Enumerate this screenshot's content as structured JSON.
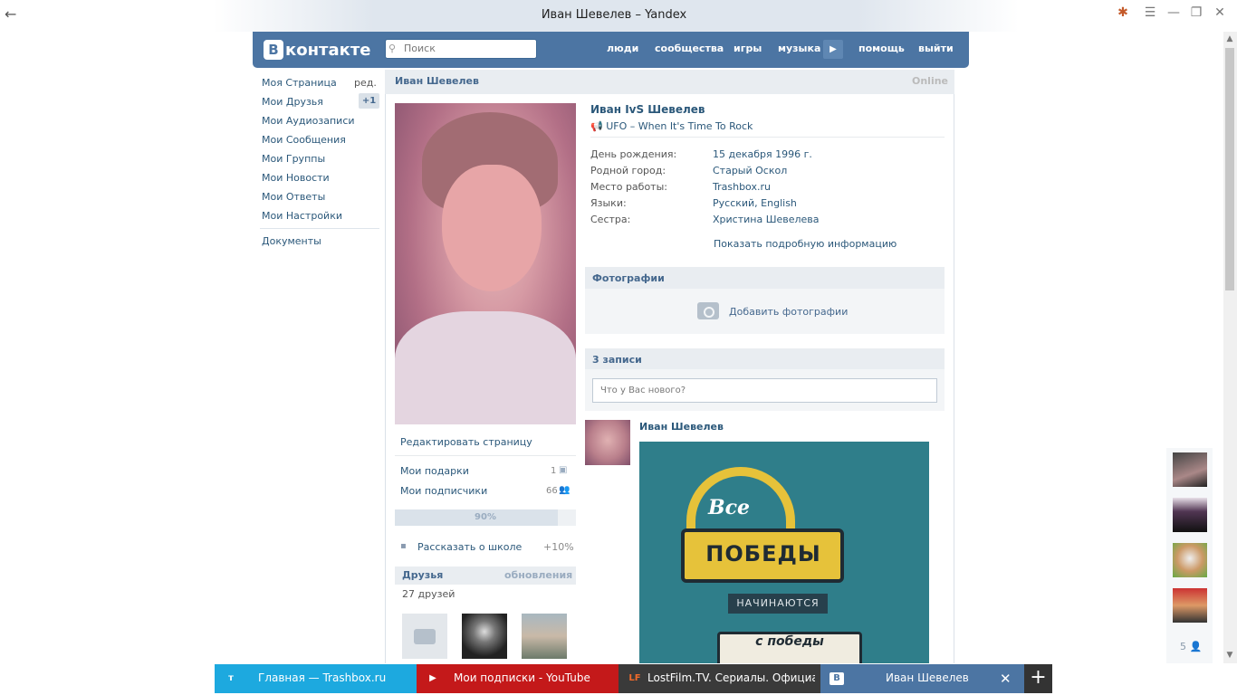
{
  "browser": {
    "window_title": "Иван Шевелев – Yandex",
    "back_glyph": "←",
    "controls": {
      "addon": "✱",
      "menu": "☰",
      "minimize": "—",
      "restore": "❐",
      "close": "✕"
    }
  },
  "header": {
    "logo_letter": "В",
    "logo_text": "контакте",
    "search_placeholder": "Поиск",
    "nav": [
      "люди",
      "сообщества",
      "игры",
      "музыка",
      "помощь",
      "выйти"
    ],
    "music_play": "▶"
  },
  "menu": {
    "edit": "ред.",
    "friends_badge": "+1",
    "items": [
      "Моя Страница",
      "Мои Друзья",
      "Мои Аудиозаписи",
      "Мои Сообщения",
      "Мои Группы",
      "Мои Новости",
      "Мои Ответы",
      "Мои Настройки"
    ],
    "documents": "Документы"
  },
  "page": {
    "header_name": "Иван Шевелев",
    "online": "Online",
    "edit_page": "Редактировать страницу",
    "gifts_label": "Мои подарки",
    "gifts_count": "1",
    "followers_label": "Мои подписчики",
    "followers_count": "66",
    "progress_label": "90%",
    "progress_value": 0.9,
    "school_label": "Рассказать о школе",
    "school_bonus": "+10%",
    "friends_title": "Друзья",
    "friends_updates": "обновления",
    "friends_count": "27 друзей"
  },
  "profile": {
    "full_name": "Иван IvS Шевелев",
    "status_icon": "speaker-icon",
    "status": "UFO – When It's Time To Rock",
    "fields": [
      {
        "label": "День рождения:",
        "value": "15 декабря 1996 г."
      },
      {
        "label": "Родной город:",
        "value": "Старый Оскол"
      },
      {
        "label": "Место работы:",
        "value": "Trashbox.ru"
      },
      {
        "label": "Языки:",
        "value": "Русский, English"
      },
      {
        "label": "Сестра:",
        "value": "Христина Шевелева"
      }
    ],
    "show_more": "Показать подробную информацию"
  },
  "photos": {
    "title": "Фотографии",
    "add": "Добавить фотографии"
  },
  "wall": {
    "title": "3 записи",
    "input_placeholder": "Что у Вас нового?"
  },
  "post": {
    "author": "Иван Шевелев",
    "image_text": {
      "script": "Все",
      "big": "ПОБЕДЫ",
      "sub": "НАЧИНАЮТСЯ",
      "lower": "с победы"
    }
  },
  "chat_rail": {
    "count": "5"
  },
  "tabs": [
    {
      "label": "Главная — Trashbox.ru",
      "favicon": "т",
      "color": "#1da9df"
    },
    {
      "label": "Мои подписки - YouTube",
      "favicon": "▶",
      "color": "#c4191a"
    },
    {
      "label": "LostFilm.TV. Сериалы. Официа...",
      "favicon": "LF",
      "color": "#3a3a3a"
    },
    {
      "label": "Иван Шевелев",
      "favicon": "В",
      "color": "#4c75a3"
    }
  ],
  "tab_close": "✕",
  "new_tab": "+"
}
